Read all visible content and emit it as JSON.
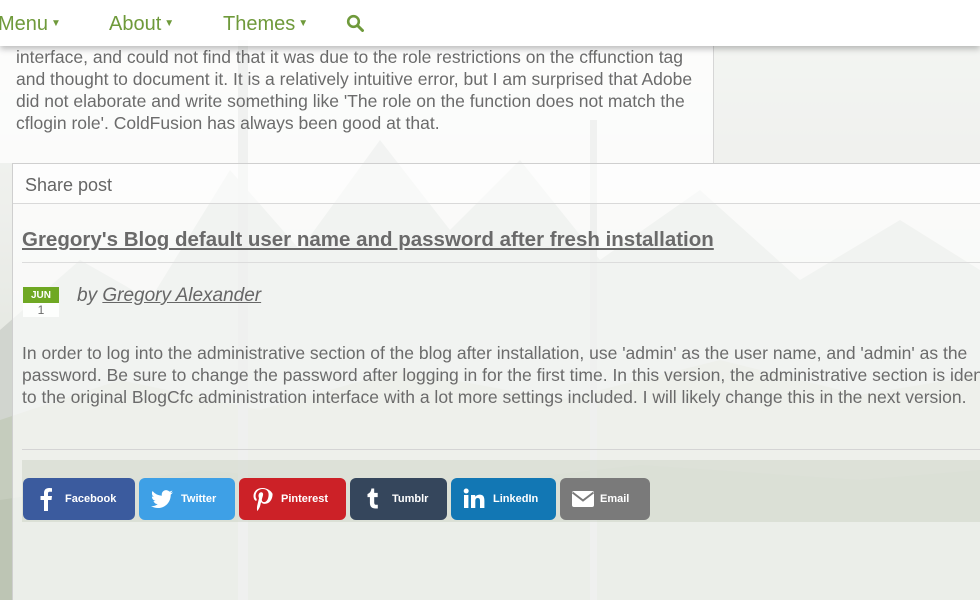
{
  "nav": {
    "menu_label": "Menu",
    "about_label": "About",
    "themes_label": "Themes",
    "search_icon": "search-icon"
  },
  "previous_post": {
    "text": "interface, and could not find that it was due to the role restrictions on the cffunction tag and thought to document it. It is a relatively intuitive error, but I am surprised that Adobe did not elaborate and write something like 'The role on the function does not match the cflogin role'. ColdFusion has always been good at that."
  },
  "share": {
    "label": "Share post"
  },
  "post": {
    "title": "Gregory's Blog default user name and password after fresh installation",
    "date_month": "JUN",
    "date_day": "1",
    "by_prefix": "by",
    "author": "Gregory Alexander",
    "body": "In order to log into the administrative section of the blog after installation, use 'admin' as the user name, and 'admin' as the password. Be sure to change the password after logging in for the first time. In this version, the administrative section is identical to the original BlogCfc administration interface with a lot more settings included. I will likely change this in the next version."
  },
  "social": {
    "facebook": "Facebook",
    "twitter": "Twitter",
    "pinterest": "Pinterest",
    "tumblr": "Tumblr",
    "linkedin": "LinkedIn",
    "email": "Email"
  },
  "colors": {
    "nav_green": "#6f9a3b",
    "date_green": "#6fa823",
    "facebook": "#3b5b9e",
    "twitter": "#3ea0e6",
    "pinterest": "#cc2127",
    "tumblr": "#35465c",
    "linkedin": "#1277b4",
    "email": "#7a7a7a"
  }
}
